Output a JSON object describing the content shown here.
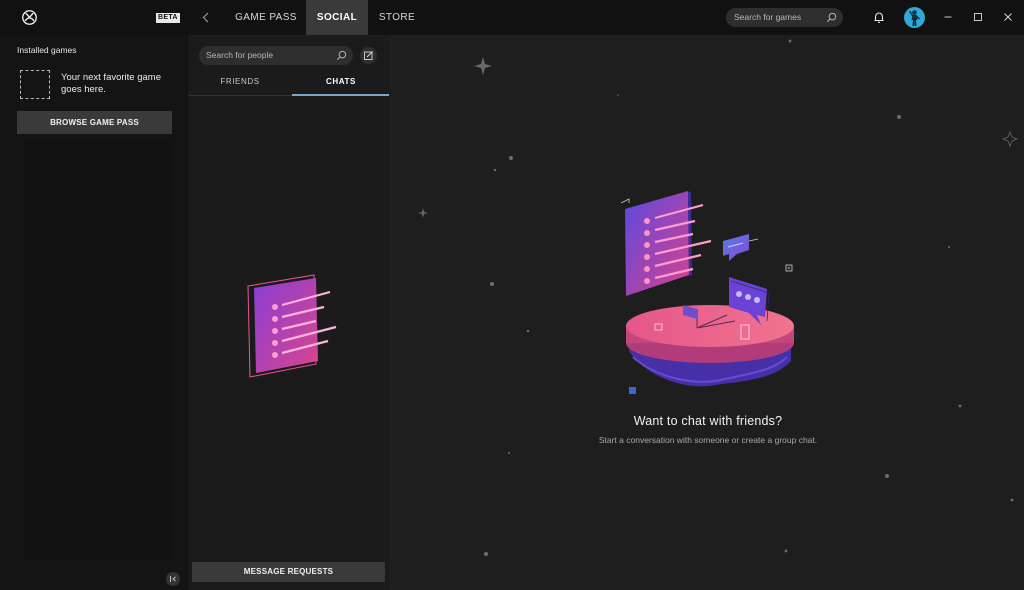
{
  "topbar": {
    "beta_badge": "BETA",
    "tabs": [
      {
        "label": "GAME PASS"
      },
      {
        "label": "SOCIAL"
      },
      {
        "label": "STORE"
      }
    ],
    "active_tab": "SOCIAL",
    "search": {
      "placeholder": "Search for games"
    },
    "icons": [
      "xbox-logo-icon",
      "back-arrow-icon",
      "search-icon",
      "bell-icon",
      "avatar",
      "minimize-icon",
      "maximize-icon",
      "close-icon"
    ]
  },
  "left_panel": {
    "title": "Installed games",
    "placeholder_text": "Your next favorite game goes here.",
    "browse_button": "BROWSE GAME PASS"
  },
  "social_panel": {
    "search": {
      "placeholder": "Search for people"
    },
    "tabs": [
      {
        "label": "FRIENDS"
      },
      {
        "label": "CHATS"
      }
    ],
    "active_tab": "CHATS",
    "message_requests_button": "MESSAGE REQUESTS"
  },
  "chat_empty_state": {
    "title": "Want to chat with friends?",
    "subtitle": "Start a conversation with someone or create a group chat."
  },
  "colors": {
    "background": "#1e1e1e",
    "topbar": "#111111",
    "active_tab": "#3a3a3a",
    "accent_underline": "#7aa6c9",
    "illustration_pink": "#e8669b",
    "illustration_purple": "#7a3fd0",
    "avatar_blue": "#2fa9d8"
  }
}
